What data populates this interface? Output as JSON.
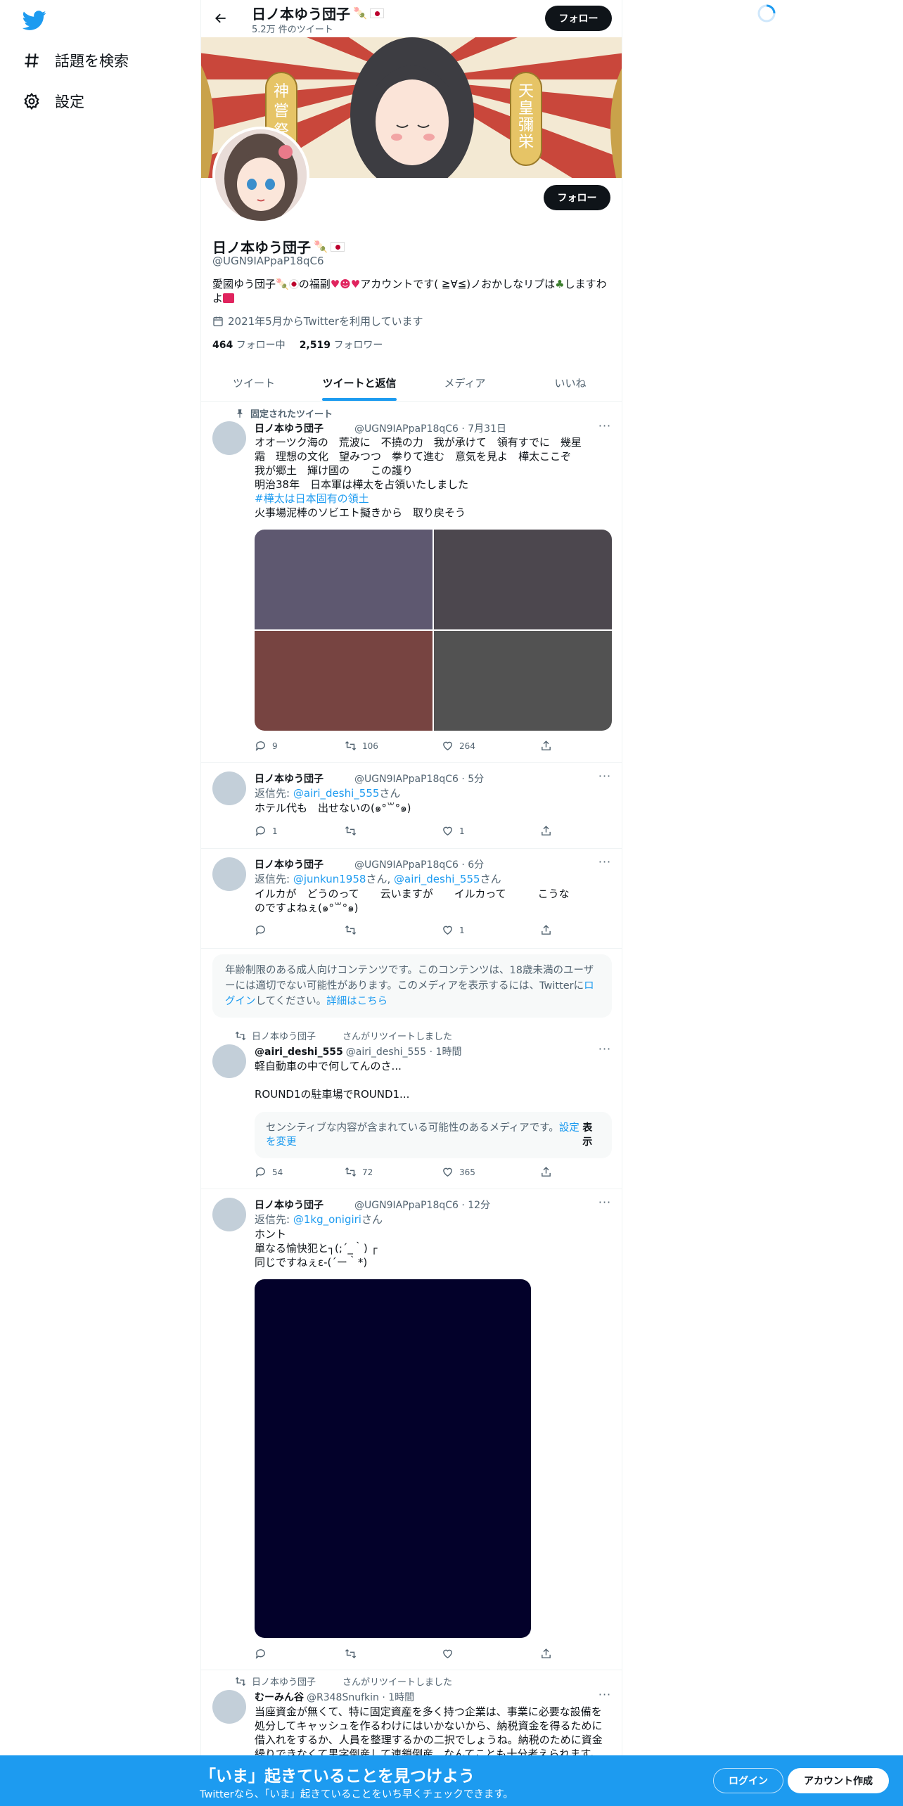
{
  "nav": {
    "explore_label": "話題を検索",
    "settings_label": "設定"
  },
  "topbar": {
    "name": "日ノ本ゆう団子",
    "tweet_count": "5.2万 件のツイート",
    "follow_label": "フォロー"
  },
  "profile": {
    "name": "日ノ本ゆう団子",
    "handle": "@UGN9IAPpaP18qC6",
    "follow_label": "フォロー",
    "bio_part1": "愛國ゆう団子",
    "bio_part2": "の福副",
    "bio_part3": "アカウントです( ≧∀≦)ノおかしなリプは",
    "bio_part4": "しますわよ",
    "joined": "2021年5月からTwitterを利用しています",
    "following_count": "464",
    "following_label": "フォロー中",
    "followers_count": "2,519",
    "followers_label": "フォロワー",
    "banner_left_text": "神嘗祭",
    "banner_right_text": "天皇彌栄"
  },
  "tabs": [
    {
      "label": "ツイート"
    },
    {
      "label": "ツイートと返信"
    },
    {
      "label": "メディア"
    },
    {
      "label": "いいね"
    }
  ],
  "tweets": {
    "t1": {
      "pinned_label": "固定されたツイート",
      "name": "日ノ本ゆう団子",
      "meta": "@UGN9IAPpaP18qC6 · 7月31日",
      "line1": "オオーツク海の　荒波に　不撓の力　我が承けて　領有すでに　幾星",
      "line2": "霜　理想の文化　望みつつ　拳りて進む　意気を見よ　樺太ここぞ",
      "line3": "我が郷土　輝け國の　　この護り",
      "line4": "明治38年　日本軍は樺太を占領いたしました",
      "hashtag": "#樺太は日本固有の領土",
      "line5": "火事場泥棒のソビエト擬きから　取り戻そう",
      "replies": "9",
      "retweets": "106",
      "likes": "264"
    },
    "t2": {
      "name": "日ノ本ゆう団子",
      "meta": "@UGN9IAPpaP18qC6 · 5分",
      "reply_prefix": "返信先:",
      "reply_to": "@airi_deshi_555",
      "reply_suffix": "さん",
      "text": "ホテル代も　出せないの(๑°꒳°๑)",
      "replies": "1",
      "likes": "1"
    },
    "t3": {
      "name": "日ノ本ゆう団子",
      "meta": "@UGN9IAPpaP18qC6 · 6分",
      "reply_prefix": "返信先:",
      "reply_to1": "@junkun1958",
      "reply_mid": "さん,",
      "reply_to2": "@airi_deshi_555",
      "reply_suffix": "さん",
      "line1": "イルカが　どうのって　　云いますが　　イルカって　　　こうな",
      "line2": "のですよねぇ(๑°꒳°๑)",
      "likes": "1"
    },
    "notice": {
      "text": "年齢制限のある成人向けコンテンツです。このコンテンツは、18歳未満のユーザーには適切でない可能性があります。このメディアを表示するには、Twitterに",
      "login_link": "ログイン",
      "text2": "してください。",
      "details_link": "詳細はこちら"
    },
    "t4": {
      "retweeted_by": "日ノ本ゆう団子",
      "retweeted_suffix": "さんがリツイートしました",
      "name": "@airi_deshi_555",
      "meta": "@airi_deshi_555 · 1時間",
      "line1": "軽自動車の中で何してんのさ...",
      "line2": "ROUND1の駐車場でROUND1...",
      "sensitive_text": "センシティブな内容が含まれている可能性のあるメディアです。",
      "sensitive_link": "設定を変更",
      "show_label": "表示",
      "replies": "54",
      "retweets": "72",
      "likes": "365"
    },
    "t5": {
      "name": "日ノ本ゆう団子",
      "meta": "@UGN9IAPpaP18qC6 · 12分",
      "reply_prefix": "返信先:",
      "reply_to": "@1kg_onigiri",
      "reply_suffix": "さん",
      "line1": "ホント",
      "line2": "單なる愉快犯と┐(;´_｀) ┌",
      "line3": "同じですねぇε-(´ー｀*)"
    },
    "t6": {
      "retweeted_by": "日ノ本ゆう団子",
      "retweeted_suffix": "さんがリツイートしました",
      "name": "むーみん谷",
      "meta": "@R348Snufkin · 1時間",
      "line1": "当座資金が無くて、特に固定資産を多く持つ企業は、事業に必要な設備を",
      "line2": "処分してキャッシュを作るわけにはいかないから、納税資金を得るために",
      "line3": "借入れをするか、人員を整理するかの二択でしょうね。納税のために資金",
      "line4": "繰りできなくて黒字倒産して連鎖倒産…なんてことも十分考えられます。"
    }
  },
  "bottombar": {
    "title": "「いま」起きていることを見つけよう",
    "subtitle": "Twitterなら、「いま」起きていることをいち早くチェックできます。",
    "login_label": "ログイン",
    "signup_label": "アカウント作成"
  },
  "colors": {
    "accent": "#1d9bf0",
    "text": "#0f1419",
    "muted": "#536471",
    "photo1": "#5e5870",
    "photo2": "#4c474e",
    "photo3": "#774441",
    "photo4": "#525252",
    "dark_media": "#03012a"
  }
}
